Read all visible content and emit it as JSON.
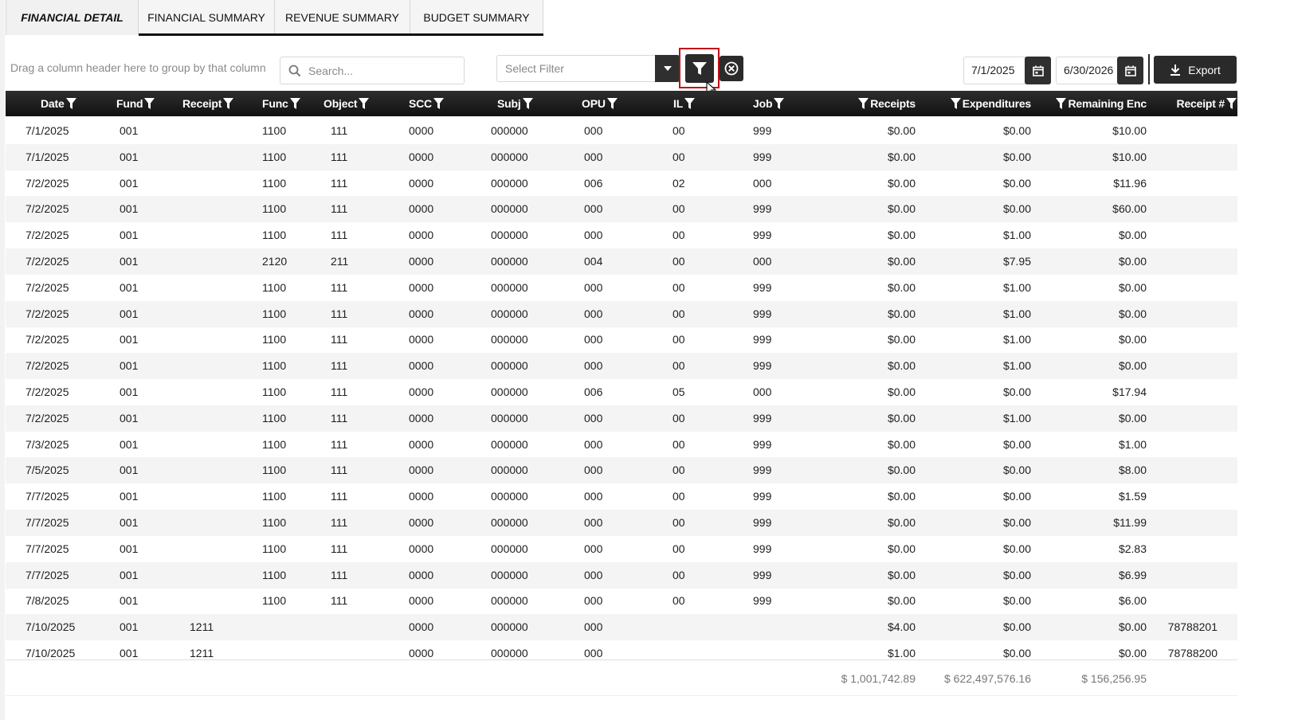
{
  "tabs": [
    {
      "label": "FINANCIAL DETAIL",
      "active": true
    },
    {
      "label": "FINANCIAL SUMMARY",
      "active": false
    },
    {
      "label": "REVENUE SUMMARY",
      "active": false
    },
    {
      "label": "BUDGET SUMMARY",
      "active": false
    }
  ],
  "toolbar": {
    "group_hint": "Drag a column header here to group by that column",
    "search_placeholder": "Search...",
    "filter_placeholder": "Select Filter",
    "start_date": "7/1/2025",
    "end_date": "6/30/2026",
    "export_label": "Export"
  },
  "columns": [
    "Date",
    "Fund",
    "Receipt",
    "Func",
    "Object",
    "SCC",
    "Subj",
    "OPU",
    "IL",
    "Job",
    "Receipts",
    "Expenditures",
    "Remaining Enc",
    "Receipt #"
  ],
  "rows": [
    [
      "7/1/2025",
      "001",
      "",
      "1100",
      "111",
      "0000",
      "000000",
      "000",
      "00",
      "999",
      "$0.00",
      "$0.00",
      "$10.00",
      ""
    ],
    [
      "7/1/2025",
      "001",
      "",
      "1100",
      "111",
      "0000",
      "000000",
      "000",
      "00",
      "999",
      "$0.00",
      "$0.00",
      "$10.00",
      ""
    ],
    [
      "7/2/2025",
      "001",
      "",
      "1100",
      "111",
      "0000",
      "000000",
      "006",
      "02",
      "000",
      "$0.00",
      "$0.00",
      "$11.96",
      ""
    ],
    [
      "7/2/2025",
      "001",
      "",
      "1100",
      "111",
      "0000",
      "000000",
      "000",
      "00",
      "999",
      "$0.00",
      "$0.00",
      "$60.00",
      ""
    ],
    [
      "7/2/2025",
      "001",
      "",
      "1100",
      "111",
      "0000",
      "000000",
      "000",
      "00",
      "999",
      "$0.00",
      "$1.00",
      "$0.00",
      ""
    ],
    [
      "7/2/2025",
      "001",
      "",
      "2120",
      "211",
      "0000",
      "000000",
      "004",
      "00",
      "000",
      "$0.00",
      "$7.95",
      "$0.00",
      ""
    ],
    [
      "7/2/2025",
      "001",
      "",
      "1100",
      "111",
      "0000",
      "000000",
      "000",
      "00",
      "999",
      "$0.00",
      "$1.00",
      "$0.00",
      ""
    ],
    [
      "7/2/2025",
      "001",
      "",
      "1100",
      "111",
      "0000",
      "000000",
      "000",
      "00",
      "999",
      "$0.00",
      "$1.00",
      "$0.00",
      ""
    ],
    [
      "7/2/2025",
      "001",
      "",
      "1100",
      "111",
      "0000",
      "000000",
      "000",
      "00",
      "999",
      "$0.00",
      "$1.00",
      "$0.00",
      ""
    ],
    [
      "7/2/2025",
      "001",
      "",
      "1100",
      "111",
      "0000",
      "000000",
      "000",
      "00",
      "999",
      "$0.00",
      "$1.00",
      "$0.00",
      ""
    ],
    [
      "7/2/2025",
      "001",
      "",
      "1100",
      "111",
      "0000",
      "000000",
      "006",
      "05",
      "000",
      "$0.00",
      "$0.00",
      "$17.94",
      ""
    ],
    [
      "7/2/2025",
      "001",
      "",
      "1100",
      "111",
      "0000",
      "000000",
      "000",
      "00",
      "999",
      "$0.00",
      "$1.00",
      "$0.00",
      ""
    ],
    [
      "7/3/2025",
      "001",
      "",
      "1100",
      "111",
      "0000",
      "000000",
      "000",
      "00",
      "999",
      "$0.00",
      "$0.00",
      "$1.00",
      ""
    ],
    [
      "7/5/2025",
      "001",
      "",
      "1100",
      "111",
      "0000",
      "000000",
      "000",
      "00",
      "999",
      "$0.00",
      "$0.00",
      "$8.00",
      ""
    ],
    [
      "7/7/2025",
      "001",
      "",
      "1100",
      "111",
      "0000",
      "000000",
      "000",
      "00",
      "999",
      "$0.00",
      "$0.00",
      "$1.59",
      ""
    ],
    [
      "7/7/2025",
      "001",
      "",
      "1100",
      "111",
      "0000",
      "000000",
      "000",
      "00",
      "999",
      "$0.00",
      "$0.00",
      "$11.99",
      ""
    ],
    [
      "7/7/2025",
      "001",
      "",
      "1100",
      "111",
      "0000",
      "000000",
      "000",
      "00",
      "999",
      "$0.00",
      "$0.00",
      "$2.83",
      ""
    ],
    [
      "7/7/2025",
      "001",
      "",
      "1100",
      "111",
      "0000",
      "000000",
      "000",
      "00",
      "999",
      "$0.00",
      "$0.00",
      "$6.99",
      ""
    ],
    [
      "7/8/2025",
      "001",
      "",
      "1100",
      "111",
      "0000",
      "000000",
      "000",
      "00",
      "999",
      "$0.00",
      "$0.00",
      "$6.00",
      ""
    ],
    [
      "7/10/2025",
      "001",
      "1211",
      "",
      "",
      "0000",
      "000000",
      "000",
      "",
      "",
      "$4.00",
      "$0.00",
      "$0.00",
      "78788201"
    ],
    [
      "7/10/2025",
      "001",
      "1211",
      "",
      "",
      "0000",
      "000000",
      "000",
      "",
      "",
      "$1.00",
      "$0.00",
      "$0.00",
      "78788200"
    ]
  ],
  "totals": {
    "receipts": "$ 1,001,742.89",
    "expenditures": "$ 622,497,576.16",
    "remaining_enc": "$ 156,256.95"
  },
  "colors": {
    "header_dark": "#111111",
    "highlight_red": "#c0101a",
    "row_alt": "#f4f4f4"
  },
  "icons": [
    "search-icon",
    "chevron-down-icon",
    "filter-icon",
    "clear-filter-icon",
    "calendar-icon",
    "download-icon",
    "column-filter-icon",
    "mouse-cursor-icon"
  ]
}
